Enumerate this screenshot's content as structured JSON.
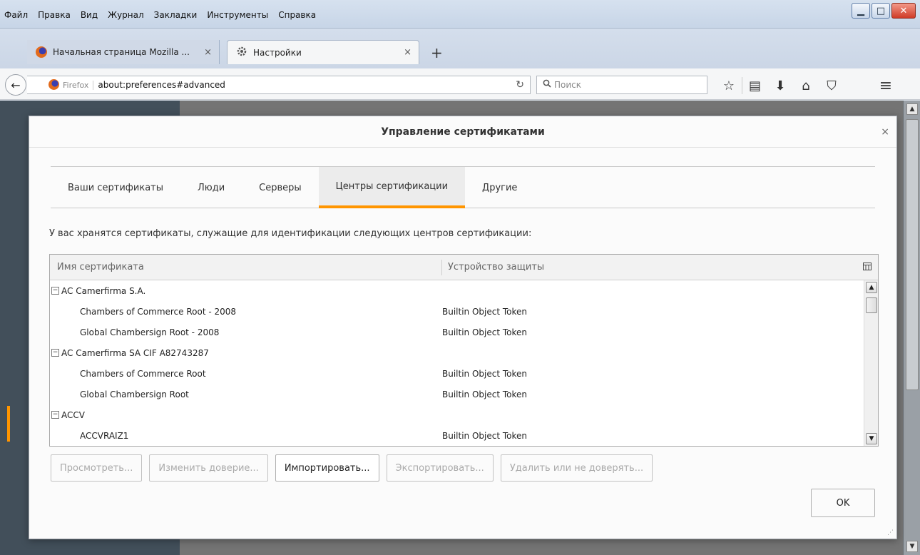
{
  "menu": {
    "items": [
      "Файл",
      "Правка",
      "Вид",
      "Журнал",
      "Закладки",
      "Инструменты",
      "Справка"
    ]
  },
  "window_controls": {
    "minimize": "▁",
    "maximize": "□",
    "close": "✕"
  },
  "tabs": [
    {
      "title": "Начальная страница Mozilla ...",
      "icon": "firefox-icon",
      "close": "×"
    },
    {
      "title": "Настройки",
      "icon": "gear-icon",
      "close": "×"
    }
  ],
  "new_tab": "+",
  "navbar": {
    "back": "←",
    "identity": "Firefox",
    "url": "about:preferences#advanced",
    "reload": "↻",
    "search_placeholder": "Поиск",
    "search_icon": "🔍",
    "icons": [
      {
        "name": "bookmark-star-icon",
        "glyph": "☆"
      },
      {
        "name": "reading-list-icon",
        "glyph": "▤"
      },
      {
        "name": "download-icon",
        "glyph": "⬇"
      },
      {
        "name": "home-icon",
        "glyph": "⌂"
      },
      {
        "name": "pocket-icon",
        "glyph": "⛉"
      },
      {
        "name": "hamburger-menu-icon",
        "glyph": "≡"
      }
    ]
  },
  "dialog": {
    "title": "Управление сертификатами",
    "close": "×",
    "tabs": [
      {
        "label": "Ваши сертификаты",
        "selected": false
      },
      {
        "label": "Люди",
        "selected": false
      },
      {
        "label": "Серверы",
        "selected": false
      },
      {
        "label": "Центры сертификации",
        "selected": true
      },
      {
        "label": "Другие",
        "selected": false
      }
    ],
    "intro": "У вас хранятся сертификаты, служащие для идентификации следующих центров сертификации:",
    "columns": {
      "name": "Имя сертификата",
      "device": "Устройство защиты"
    },
    "rows": [
      {
        "type": "group",
        "name": "AC Camerfirma S.A.",
        "device": ""
      },
      {
        "type": "item",
        "name": "Chambers of Commerce Root - 2008",
        "device": "Builtin Object Token"
      },
      {
        "type": "item",
        "name": "Global Chambersign Root - 2008",
        "device": "Builtin Object Token"
      },
      {
        "type": "group",
        "name": "AC Camerfirma SA CIF A82743287",
        "device": ""
      },
      {
        "type": "item",
        "name": "Chambers of Commerce Root",
        "device": "Builtin Object Token"
      },
      {
        "type": "item",
        "name": "Global Chambersign Root",
        "device": "Builtin Object Token"
      },
      {
        "type": "group",
        "name": "ACCV",
        "device": ""
      },
      {
        "type": "item",
        "name": "ACCVRAIZ1",
        "device": "Builtin Object Token"
      }
    ],
    "buttons": {
      "view": "Просмотреть...",
      "edit_trust": "Изменить доверие...",
      "import": "Импортировать...",
      "export": "Экспортировать...",
      "delete": "Удалить или не доверять...",
      "ok": "OK"
    }
  }
}
